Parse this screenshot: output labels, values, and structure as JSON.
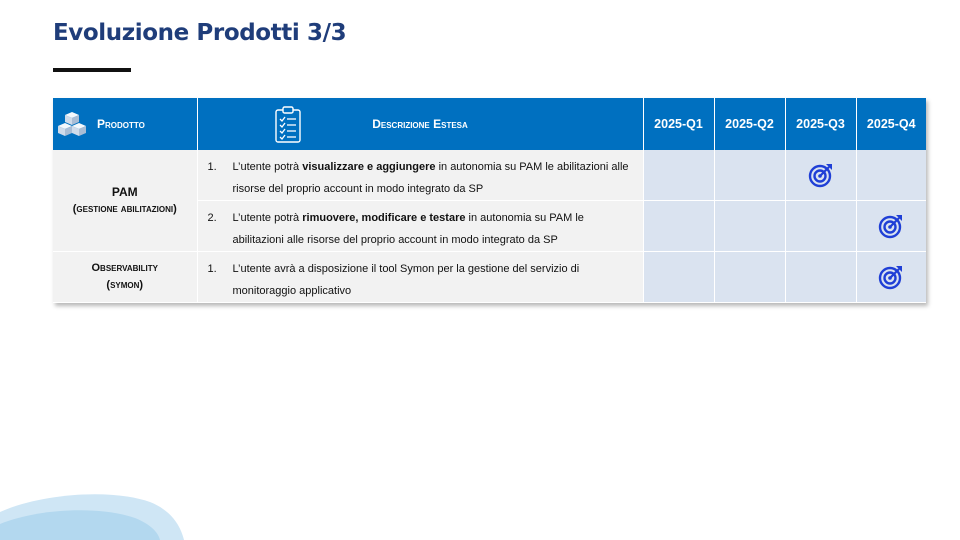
{
  "slide": {
    "title": "Evoluzione Prodotti 3/3"
  },
  "table": {
    "headers": {
      "product": "Prodotto",
      "description": "Descrizione Estesa",
      "quarters": [
        "2025-Q1",
        "2025-Q2",
        "2025-Q3",
        "2025-Q4"
      ]
    },
    "rows": [
      {
        "product_name": "PAM",
        "product_sub": "(gestione abilitazioni)",
        "items": [
          {
            "num": "1.",
            "text_before": "L’utente potrà ",
            "text_bold": "visualizzare e aggiungere",
            "text_after": " in autonomia su PAM le abilitazioni alle risorse del proprio account in modo integrato da SP",
            "target_quarter": "2025-Q3"
          },
          {
            "num": "2.",
            "text_before": "L’utente potrà ",
            "text_bold": "rimuovere, modificare e testare",
            "text_after": " in autonomia su PAM le abilitazioni alle risorse del proprio account in modo integrato da SP",
            "target_quarter": "2025-Q4"
          }
        ]
      },
      {
        "product_name": "Observability",
        "product_sub": "(symon)",
        "items": [
          {
            "num": "1.",
            "text_before": "L’utente avrà a disposizione il tool Symon per la gestione del servizio di monitoraggio applicativo",
            "text_bold": "",
            "text_after": "",
            "target_quarter": "2025-Q4"
          }
        ]
      }
    ]
  },
  "icons": {
    "header_product": "cubes-icon",
    "header_description": "clipboard-checklist-icon",
    "milestone": "target-icon"
  },
  "colors": {
    "header_bg": "#0070c0",
    "title": "#1f3d7a",
    "quarter_cell": "#dae3f0",
    "row_bg": "#f2f2f2",
    "target": "#1f3fd6"
  }
}
